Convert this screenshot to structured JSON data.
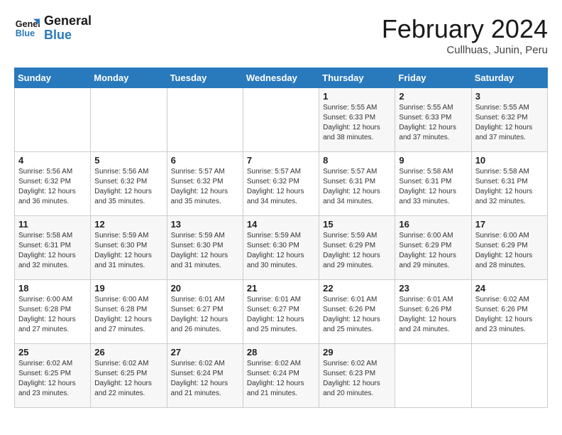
{
  "logo": {
    "line1": "General",
    "line2": "Blue"
  },
  "title": "February 2024",
  "subtitle": "Cullhuas, Junin, Peru",
  "weekdays": [
    "Sunday",
    "Monday",
    "Tuesday",
    "Wednesday",
    "Thursday",
    "Friday",
    "Saturday"
  ],
  "weeks": [
    [
      {
        "day": "",
        "info": ""
      },
      {
        "day": "",
        "info": ""
      },
      {
        "day": "",
        "info": ""
      },
      {
        "day": "",
        "info": ""
      },
      {
        "day": "1",
        "info": "Sunrise: 5:55 AM\nSunset: 6:33 PM\nDaylight: 12 hours\nand 38 minutes."
      },
      {
        "day": "2",
        "info": "Sunrise: 5:55 AM\nSunset: 6:33 PM\nDaylight: 12 hours\nand 37 minutes."
      },
      {
        "day": "3",
        "info": "Sunrise: 5:55 AM\nSunset: 6:32 PM\nDaylight: 12 hours\nand 37 minutes."
      }
    ],
    [
      {
        "day": "4",
        "info": "Sunrise: 5:56 AM\nSunset: 6:32 PM\nDaylight: 12 hours\nand 36 minutes."
      },
      {
        "day": "5",
        "info": "Sunrise: 5:56 AM\nSunset: 6:32 PM\nDaylight: 12 hours\nand 35 minutes."
      },
      {
        "day": "6",
        "info": "Sunrise: 5:57 AM\nSunset: 6:32 PM\nDaylight: 12 hours\nand 35 minutes."
      },
      {
        "day": "7",
        "info": "Sunrise: 5:57 AM\nSunset: 6:32 PM\nDaylight: 12 hours\nand 34 minutes."
      },
      {
        "day": "8",
        "info": "Sunrise: 5:57 AM\nSunset: 6:31 PM\nDaylight: 12 hours\nand 34 minutes."
      },
      {
        "day": "9",
        "info": "Sunrise: 5:58 AM\nSunset: 6:31 PM\nDaylight: 12 hours\nand 33 minutes."
      },
      {
        "day": "10",
        "info": "Sunrise: 5:58 AM\nSunset: 6:31 PM\nDaylight: 12 hours\nand 32 minutes."
      }
    ],
    [
      {
        "day": "11",
        "info": "Sunrise: 5:58 AM\nSunset: 6:31 PM\nDaylight: 12 hours\nand 32 minutes."
      },
      {
        "day": "12",
        "info": "Sunrise: 5:59 AM\nSunset: 6:30 PM\nDaylight: 12 hours\nand 31 minutes."
      },
      {
        "day": "13",
        "info": "Sunrise: 5:59 AM\nSunset: 6:30 PM\nDaylight: 12 hours\nand 31 minutes."
      },
      {
        "day": "14",
        "info": "Sunrise: 5:59 AM\nSunset: 6:30 PM\nDaylight: 12 hours\nand 30 minutes."
      },
      {
        "day": "15",
        "info": "Sunrise: 5:59 AM\nSunset: 6:29 PM\nDaylight: 12 hours\nand 29 minutes."
      },
      {
        "day": "16",
        "info": "Sunrise: 6:00 AM\nSunset: 6:29 PM\nDaylight: 12 hours\nand 29 minutes."
      },
      {
        "day": "17",
        "info": "Sunrise: 6:00 AM\nSunset: 6:29 PM\nDaylight: 12 hours\nand 28 minutes."
      }
    ],
    [
      {
        "day": "18",
        "info": "Sunrise: 6:00 AM\nSunset: 6:28 PM\nDaylight: 12 hours\nand 27 minutes."
      },
      {
        "day": "19",
        "info": "Sunrise: 6:00 AM\nSunset: 6:28 PM\nDaylight: 12 hours\nand 27 minutes."
      },
      {
        "day": "20",
        "info": "Sunrise: 6:01 AM\nSunset: 6:27 PM\nDaylight: 12 hours\nand 26 minutes."
      },
      {
        "day": "21",
        "info": "Sunrise: 6:01 AM\nSunset: 6:27 PM\nDaylight: 12 hours\nand 25 minutes."
      },
      {
        "day": "22",
        "info": "Sunrise: 6:01 AM\nSunset: 6:26 PM\nDaylight: 12 hours\nand 25 minutes."
      },
      {
        "day": "23",
        "info": "Sunrise: 6:01 AM\nSunset: 6:26 PM\nDaylight: 12 hours\nand 24 minutes."
      },
      {
        "day": "24",
        "info": "Sunrise: 6:02 AM\nSunset: 6:26 PM\nDaylight: 12 hours\nand 23 minutes."
      }
    ],
    [
      {
        "day": "25",
        "info": "Sunrise: 6:02 AM\nSunset: 6:25 PM\nDaylight: 12 hours\nand 23 minutes."
      },
      {
        "day": "26",
        "info": "Sunrise: 6:02 AM\nSunset: 6:25 PM\nDaylight: 12 hours\nand 22 minutes."
      },
      {
        "day": "27",
        "info": "Sunrise: 6:02 AM\nSunset: 6:24 PM\nDaylight: 12 hours\nand 21 minutes."
      },
      {
        "day": "28",
        "info": "Sunrise: 6:02 AM\nSunset: 6:24 PM\nDaylight: 12 hours\nand 21 minutes."
      },
      {
        "day": "29",
        "info": "Sunrise: 6:02 AM\nSunset: 6:23 PM\nDaylight: 12 hours\nand 20 minutes."
      },
      {
        "day": "",
        "info": ""
      },
      {
        "day": "",
        "info": ""
      }
    ]
  ]
}
